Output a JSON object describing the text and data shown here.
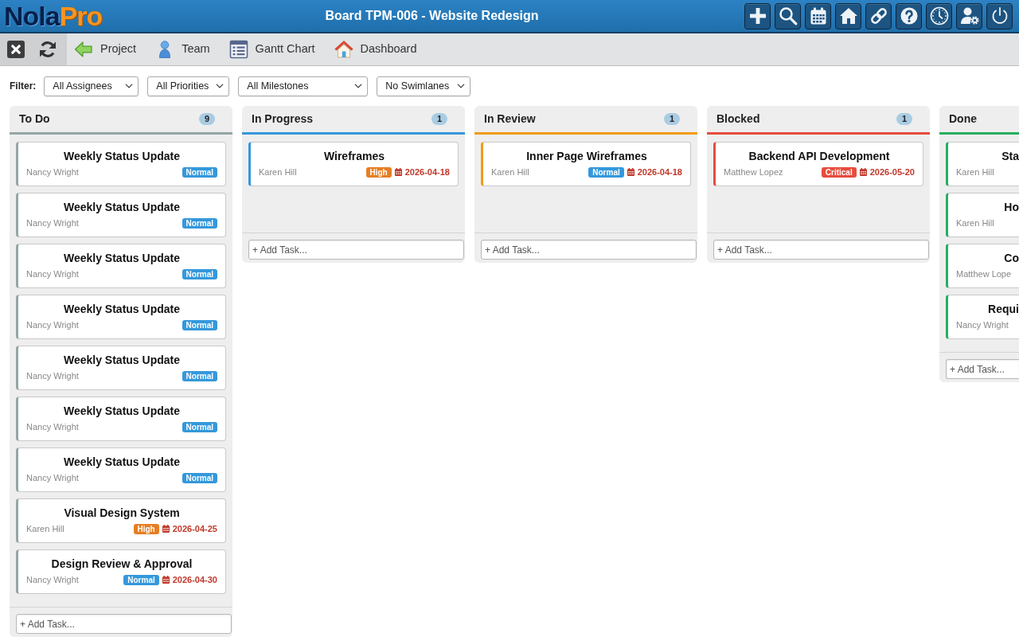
{
  "top_bar": {
    "logo": [
      "Nola",
      "Pro"
    ],
    "title": "Board TPM-006 - Website Redesign",
    "buttons": [
      {
        "kind": "add"
      },
      {
        "kind": "search"
      },
      {
        "kind": "calendar"
      },
      {
        "kind": "home"
      },
      {
        "kind": "link"
      },
      {
        "kind": "help"
      },
      {
        "kind": "clock"
      },
      {
        "kind": "user-settings"
      },
      {
        "kind": "power"
      }
    ]
  },
  "toolbar": {
    "tools": [
      {
        "kind": "close"
      },
      {
        "kind": "refresh"
      }
    ],
    "nav": [
      {
        "label": "Project",
        "kind": "project"
      },
      {
        "label": "Team",
        "kind": "team"
      },
      {
        "label": "Gantt Chart",
        "kind": "gantt"
      },
      {
        "label": "Dashboard",
        "kind": "dashboard"
      }
    ]
  },
  "filter": {
    "label": "Filter:",
    "dropdowns": [
      {
        "value": "All Assignees"
      },
      {
        "value": "All Priorities"
      },
      {
        "value": "All Milestones"
      },
      {
        "value": "No Swimlanes"
      }
    ]
  },
  "columns": [
    {
      "title": "To Do",
      "count": "9",
      "color": "#95a5a6",
      "add_task_placeholder": "+ Add Task...",
      "cards": [
        {
          "title": "Weekly Status Update",
          "assignee": "Nancy Wright",
          "priority": {
            "label": "Normal",
            "color": "#3498db"
          }
        },
        {
          "title": "Weekly Status Update",
          "assignee": "Nancy Wright",
          "priority": {
            "label": "Normal",
            "color": "#3498db"
          }
        },
        {
          "title": "Weekly Status Update",
          "assignee": "Nancy Wright",
          "priority": {
            "label": "Normal",
            "color": "#3498db"
          }
        },
        {
          "title": "Weekly Status Update",
          "assignee": "Nancy Wright",
          "priority": {
            "label": "Normal",
            "color": "#3498db"
          }
        },
        {
          "title": "Weekly Status Update",
          "assignee": "Nancy Wright",
          "priority": {
            "label": "Normal",
            "color": "#3498db"
          }
        },
        {
          "title": "Weekly Status Update",
          "assignee": "Nancy Wright",
          "priority": {
            "label": "Normal",
            "color": "#3498db"
          }
        },
        {
          "title": "Weekly Status Update",
          "assignee": "Nancy Wright",
          "priority": {
            "label": "Normal",
            "color": "#3498db"
          }
        },
        {
          "title": "Visual Design System",
          "assignee": "Karen Hill",
          "priority": {
            "label": "High",
            "color": "#e67e22"
          },
          "due": "2026-04-25"
        },
        {
          "title": "Design Review & Approval",
          "assignee": "Nancy Wright",
          "priority": {
            "label": "Normal",
            "color": "#3498db"
          },
          "due": "2026-04-30"
        }
      ]
    },
    {
      "title": "In Progress",
      "count": "1",
      "color": "#3498db",
      "add_task_placeholder": "+ Add Task...",
      "cards": [
        {
          "title": "Wireframes",
          "assignee": "Karen Hill",
          "priority": {
            "label": "High",
            "color": "#e67e22"
          },
          "due": "2026-04-18"
        }
      ]
    },
    {
      "title": "In Review",
      "count": "1",
      "color": "#f39c12",
      "add_task_placeholder": "+ Add Task...",
      "cards": [
        {
          "title": "Inner Page Wireframes",
          "assignee": "Karen Hill",
          "priority": {
            "label": "Normal",
            "color": "#3498db"
          },
          "due": "2026-04-18"
        }
      ]
    },
    {
      "title": "Blocked",
      "count": "1",
      "color": "#e74c3c",
      "add_task_placeholder": "+ Add Task...",
      "cards": [
        {
          "title": "Backend API Development",
          "assignee": "Matthew Lopez",
          "priority": {
            "label": "Critical",
            "color": "#e74c3c"
          },
          "due": "2026-05-20"
        }
      ]
    },
    {
      "title": "Done",
      "color": "#27ae60",
      "add_task_placeholder": "+ Add Task...",
      "cards": [
        {
          "title": "Sta",
          "assignee": "Karen Hill"
        },
        {
          "title": "Ho",
          "assignee": "Karen Hill"
        },
        {
          "title": "Co",
          "assignee": "Matthew Lope"
        },
        {
          "title": "Requi",
          "assignee": "Nancy Wright"
        }
      ]
    }
  ]
}
